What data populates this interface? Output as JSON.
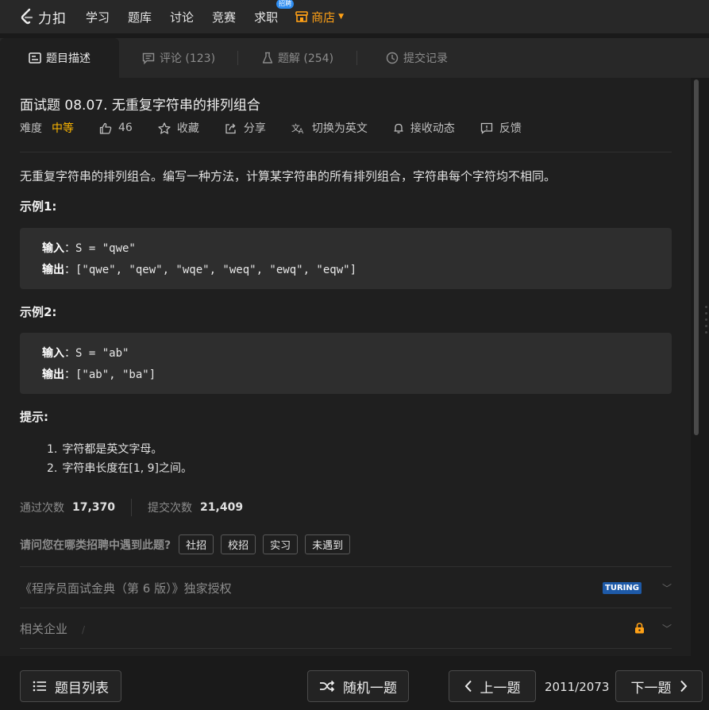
{
  "nav": {
    "logo_text": "力扣",
    "items": [
      "学习",
      "题库",
      "讨论",
      "竞赛",
      "求职"
    ],
    "hire_badge": "招聘",
    "store": "商店",
    "accent": "#ffa116"
  },
  "tabs": [
    {
      "label": "题目描述",
      "icon": "description-icon"
    },
    {
      "label": "评论 (123)",
      "icon": "comment-icon"
    },
    {
      "label": "题解 (254)",
      "icon": "flask-icon"
    },
    {
      "label": "提交记录",
      "icon": "clock-icon"
    }
  ],
  "problem": {
    "title": "面试题 08.07. 无重复字符串的排列组合",
    "difficulty_label": "难度",
    "difficulty": "中等",
    "difficulty_color": "#ffb800",
    "likes": "46",
    "favorite": "收藏",
    "share": "分享",
    "switch_lang": "切换为英文",
    "notify": "接收动态",
    "feedback": "反馈",
    "description": "无重复字符串的排列组合。编写一种方法，计算某字符串的所有排列组合，字符串每个字符均不相同。",
    "example1_title": "示例1:",
    "example1": {
      "in_label": "输入",
      "in_value": "：S = \"qwe\"",
      "out_label": "输出",
      "out_value": "：[\"qwe\", \"qew\", \"wqe\", \"weq\", \"ewq\", \"eqw\"]"
    },
    "example2_title": "示例2:",
    "example2": {
      "in_label": "输入",
      "in_value": "：S = \"ab\"",
      "out_label": "输出",
      "out_value": "：[\"ab\", \"ba\"]"
    },
    "hint_title": "提示:",
    "hints": [
      {
        "num": "1.",
        "text": "字符都是英文字母。"
      },
      {
        "num": "2.",
        "text": "字符串长度在[1, 9]之间。"
      }
    ],
    "accepted_label": "通过次数",
    "accepted": "17,370",
    "submissions_label": "提交次数",
    "submissions": "21,409",
    "question": "请问您在哪类招聘中遇到此题?",
    "chips": [
      "社招",
      "校招",
      "实习",
      "未遇到"
    ],
    "book": "《程序员面试金典（第 6 版）》独家授权",
    "book_badge": "TURING",
    "companies": "相关企业",
    "companies_sep": "/"
  },
  "footer": {
    "problem_list": "题目列表",
    "random": "随机一题",
    "prev": "上一题",
    "page": "2011/2073",
    "next": "下一题"
  }
}
